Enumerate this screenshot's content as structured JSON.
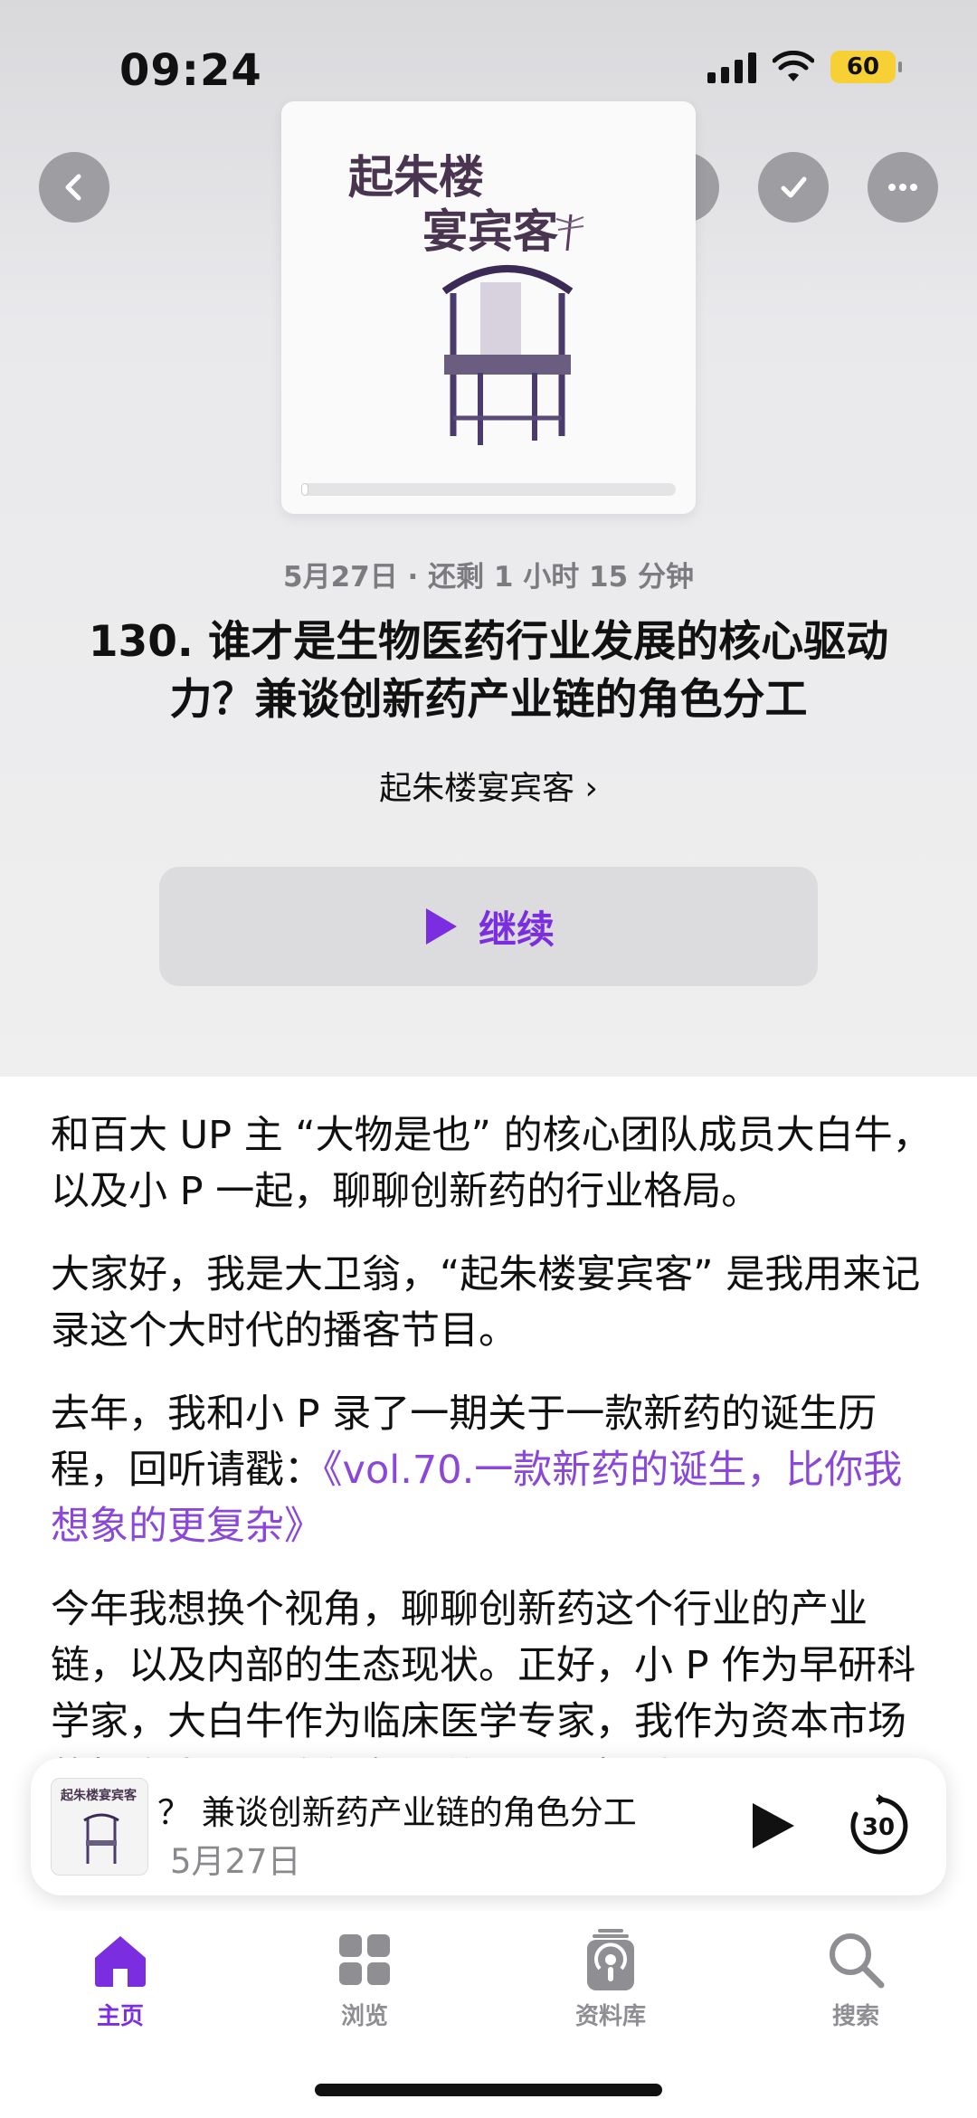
{
  "status": {
    "time": "09:24",
    "battery": "60"
  },
  "artwork": {
    "title_line1": "起朱楼",
    "title_line2": "宴宾客",
    "playback_fraction": 0.02
  },
  "episode": {
    "meta": "5月27日 · 还剩 1 小时 15 分钟",
    "title": "130. 谁才是生物医药行业发展的核心驱动力？兼谈创新药产业链的角色分工",
    "show_name": "起朱楼宴宾客 ›",
    "continue_label": "继续"
  },
  "description": {
    "p1": "和百大 UP 主 “大物是也” 的核心团队成员大白牛，以及小 P 一起，聊聊创新药的行业格局。",
    "p2": "大家好，我是大卫翁，“起朱楼宴宾客” 是我用来记录这个大时代的播客节目。",
    "p3_prefix": "去年，我和小 P 录了一期关于一款新药的诞生历程，回听请戳：",
    "p3_link": "《vol.70.一款新药的诞生，比你我想象的更复杂》",
    "p4": "今年我想换个视角，聊聊创新药这个行业的产业链，以及内部的生态现状。正好，小 P 作为早研科学家，大白牛作为临床医学专家，我作为资本市场的投资人，三个视角加总，可以探讨"
  },
  "mini_player": {
    "title": "？ 兼谈创新药产业链的角色分工",
    "date": "5月27日",
    "art_title": "起朱楼宴宾客",
    "skip_seconds": "30"
  },
  "tabs": [
    {
      "label": "主页",
      "icon": "house-icon",
      "active": true
    },
    {
      "label": "浏览",
      "icon": "grid-icon",
      "active": false
    },
    {
      "label": "资料库",
      "icon": "library-icon",
      "active": false
    },
    {
      "label": "搜索",
      "icon": "search-icon",
      "active": false
    }
  ],
  "colors": {
    "accent": "#7b2ee0",
    "link": "#8b47d8"
  }
}
